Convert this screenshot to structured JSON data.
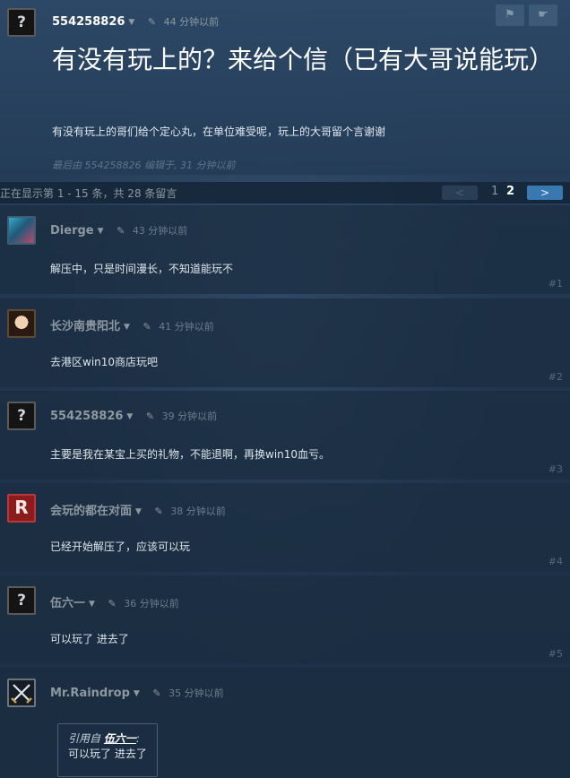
{
  "topic": {
    "author": "554258826",
    "time": "44 分钟以前",
    "title": "有没有玩上的？来给个信（已有大哥说能玩）",
    "body": "有没有玩上的哥们给个定心丸，在单位难受呢，玩上的大哥留个言谢谢",
    "edited": "最后由 554258826 编辑于, 31 分钟以前",
    "icons": [
      "flag-icon",
      "pointing-hand-icon"
    ]
  },
  "pagination": {
    "info": "正在显示第 1 - 15 条，共 28 条留言",
    "prev_label": "<",
    "next_label": ">",
    "pages": [
      "1",
      "2"
    ],
    "current_page": "2"
  },
  "comments": [
    {
      "author": "Dierge",
      "time": "43 分钟以前",
      "text": "解压中，只是时间漫长，不知道能玩不",
      "num": "#1",
      "avatar": "character-avatar"
    },
    {
      "author": "长沙南贵阳北",
      "time": "41 分钟以前",
      "text": "去港区win10商店玩吧",
      "num": "#2",
      "avatar": "photo-avatar"
    },
    {
      "author": "554258826",
      "time": "39 分钟以前",
      "text": "主要是我在某宝上买的礼物，不能退啊，再换win10血亏。",
      "num": "#3",
      "avatar": "question-mark-avatar"
    },
    {
      "author": "会玩的都在对面",
      "time": "38 分钟以前",
      "text": "已经开始解压了，应该可以玩",
      "num": "#4",
      "avatar": "letter-r-avatar"
    },
    {
      "author": "伍六一",
      "time": "36 分钟以前",
      "text": "可以玩了 进去了",
      "num": "#5",
      "avatar": "question-mark-avatar"
    },
    {
      "author": "Mr.Raindrop",
      "time": "35 分钟以前",
      "quote_prefix": "引用自",
      "quote_author": "伍六一",
      "quote_colon": ":",
      "quote_text": "可以玩了 进去了",
      "avatar": "crossed-swords-avatar"
    }
  ],
  "avatar_glyph_q": "?",
  "avatar_glyph_r": "R"
}
